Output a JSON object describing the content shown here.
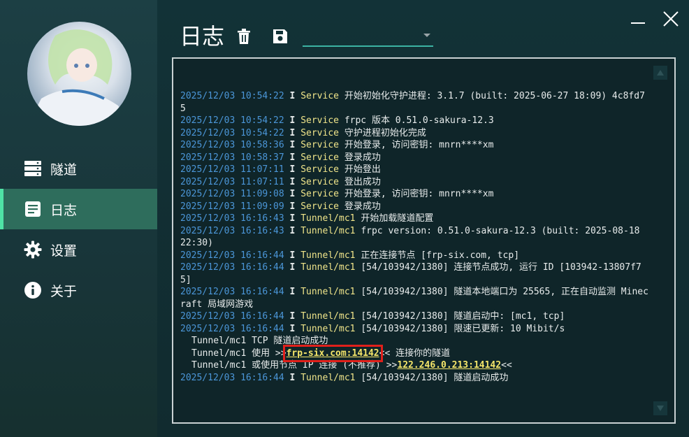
{
  "nav": [
    {
      "label": "隧道",
      "icon": "server-icon"
    },
    {
      "label": "日志",
      "icon": "document-icon"
    },
    {
      "label": "设置",
      "icon": "gear-icon"
    },
    {
      "label": "关于",
      "icon": "info-icon"
    }
  ],
  "page_title": "日志",
  "select": {
    "value": ""
  },
  "colors": {
    "accent": "#4fe3a6",
    "active_bg": "#2e6d5c",
    "timestamp": "#4b96d8",
    "highlight": "#f5e66a"
  },
  "logs": [
    {
      "ts": "2025/12/03 10:54:22",
      "lvl": "I",
      "src": "Service",
      "msg": "开始初始化守护进程: 3.1.7 (built: 2025-06-27 18:09) 4c8fd75"
    },
    {
      "ts": "2025/12/03 10:54:22",
      "lvl": "I",
      "src": "Service",
      "msg": "frpc 版本 0.51.0-sakura-12.3"
    },
    {
      "ts": "2025/12/03 10:54:22",
      "lvl": "I",
      "src": "Service",
      "msg": "守护进程初始化完成"
    },
    {
      "ts": "2025/12/03 10:58:36",
      "lvl": "I",
      "src": "Service",
      "msg": "开始登录, 访问密钥: mnrn****xm"
    },
    {
      "ts": "2025/12/03 10:58:37",
      "lvl": "I",
      "src": "Service",
      "msg": "登录成功"
    },
    {
      "ts": "2025/12/03 11:07:11",
      "lvl": "I",
      "src": "Service",
      "msg": "开始登出"
    },
    {
      "ts": "2025/12/03 11:07:11",
      "lvl": "I",
      "src": "Service",
      "msg": "登出成功"
    },
    {
      "ts": "2025/12/03 11:09:08",
      "lvl": "I",
      "src": "Service",
      "msg": "开始登录, 访问密钥: mnrn****xm"
    },
    {
      "ts": "2025/12/03 11:09:09",
      "lvl": "I",
      "src": "Service",
      "msg": "登录成功"
    },
    {
      "ts": "2025/12/03 16:16:43",
      "lvl": "I",
      "src": "Tunnel/mc1",
      "msg": "开始加载隧道配置"
    },
    {
      "ts": "2025/12/03 16:16:43",
      "lvl": "I",
      "src": "Tunnel/mc1",
      "msg": "frpc version: 0.51.0-sakura-12.3 (built: 2025-08-18 22:30)"
    },
    {
      "ts": "2025/12/03 16:16:44",
      "lvl": "I",
      "src": "Tunnel/mc1",
      "msg": "正在连接节点 [frp-six.com, tcp]"
    },
    {
      "ts": "2025/12/03 16:16:44",
      "lvl": "I",
      "src": "Tunnel/mc1",
      "msg": "[54/103942/1380] 连接节点成功, 运行 ID [103942-13807f75]"
    },
    {
      "ts": "2025/12/03 16:16:44",
      "lvl": "I",
      "src": "Tunnel/mc1",
      "msg": "[54/103942/1380] 隧道本地端口为 25565, 正在自动监测 Minecraft 局域网游戏"
    },
    {
      "ts": "2025/12/03 16:16:44",
      "lvl": "I",
      "src": "Tunnel/mc1",
      "msg": "[54/103942/1380] 隧道启动中: [mc1, tcp]"
    },
    {
      "ts": "2025/12/03 16:16:44",
      "lvl": "I",
      "src": "Tunnel/mc1",
      "msg": "[54/103942/1380] 限速已更新: 10 Mibit/s"
    }
  ],
  "info_block": {
    "line1": "Tunnel/mc1 TCP 隧道启动成功",
    "line2_pre": "Tunnel/mc1 使用 >>",
    "line2_addr": "frp-six.com:14142",
    "line2_post": "<< 连接你的隧道",
    "line3_pre": "Tunnel/mc1 或使用节点 IP 连接 (不推荐) >>",
    "line3_addr": "122.246.0.213:14142",
    "line3_post": "<<"
  },
  "last_log": {
    "ts": "2025/12/03 16:16:44",
    "lvl": "I",
    "src": "Tunnel/mc1",
    "msg": "[54/103942/1380] 隧道启动成功"
  }
}
